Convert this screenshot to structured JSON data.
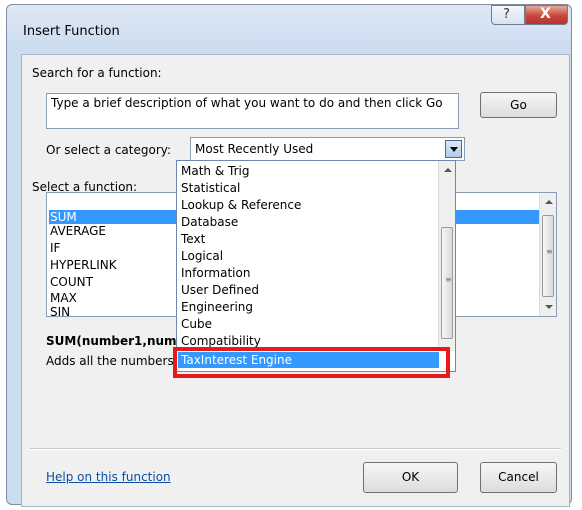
{
  "window": {
    "title": "Insert Function",
    "help_glyph": "?",
    "close_glyph": "X"
  },
  "search": {
    "label": "Search for a function:",
    "text": "Type a brief description of what you want to do and then click Go",
    "go_label": "Go"
  },
  "category": {
    "label": "Or select a category:",
    "selected": "Most Recently Used",
    "options": [
      "Math & Trig",
      "Statistical",
      "Lookup & Reference",
      "Database",
      "Text",
      "Logical",
      "Information",
      "User Defined",
      "Engineering",
      "Cube",
      "Compatibility",
      "TaxInterest Engine"
    ],
    "highlighted_option": "TaxInterest Engine"
  },
  "functions": {
    "label": "Select a function:",
    "items": [
      "SUM",
      "AVERAGE",
      "IF",
      "HYPERLINK",
      "COUNT",
      "MAX",
      "SIN"
    ],
    "selected": "SUM"
  },
  "description": {
    "syntax": "SUM(number1,num",
    "text": "Adds all the numbers i"
  },
  "footer": {
    "help_link": "Help on this function",
    "ok_label": "OK",
    "cancel_label": "Cancel"
  },
  "colors": {
    "selection": "#3399ff",
    "annotation": "#e51b1b",
    "link": "#0b4ea8"
  }
}
